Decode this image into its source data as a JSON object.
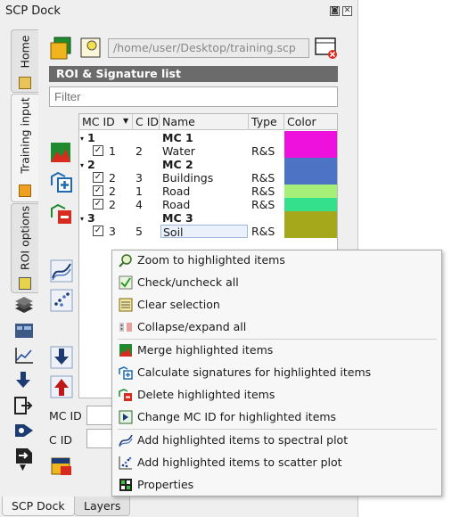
{
  "dock": {
    "title": "SCP Dock",
    "float_glyph": "◙",
    "close_glyph": "✕"
  },
  "vertical_tabs": [
    "Home",
    "Training input",
    "ROI options"
  ],
  "toolbar": {
    "path": "/home/user/Desktop/training.scp"
  },
  "roi_list": {
    "header": "ROI & Signature list",
    "filter_placeholder": "Filter",
    "columns": [
      "MC ID",
      "C ID",
      "Name",
      "Type",
      "Color"
    ],
    "sort_glyph": "▼",
    "groups": [
      {
        "mc_id": "1",
        "name": "MC 1",
        "color": "#ee11dd",
        "items": [
          {
            "mc_id": "1",
            "c_id": "2",
            "name": "Water",
            "type": "R&S",
            "color": "#ee11dd"
          }
        ]
      },
      {
        "mc_id": "2",
        "name": "MC 2",
        "color": "#4d74c4",
        "items": [
          {
            "mc_id": "2",
            "c_id": "3",
            "name": "Buildings",
            "type": "R&S",
            "color": "#4d74c4"
          },
          {
            "mc_id": "2",
            "c_id": "1",
            "name": "Road",
            "type": "R&S",
            "color": "#a6f07a"
          },
          {
            "mc_id": "2",
            "c_id": "4",
            "name": "Road",
            "type": "R&S",
            "color": "#35e08c"
          }
        ]
      },
      {
        "mc_id": "3",
        "name": "MC 3",
        "color": "#a6a81b",
        "items": [
          {
            "mc_id": "3",
            "c_id": "5",
            "name": "Soil",
            "type": "R&S",
            "color": "#a6a81b"
          }
        ]
      }
    ]
  },
  "fields": {
    "mc_id_label": "MC ID",
    "c_id_label": "C ID"
  },
  "bottom_tabs": [
    "SCP Dock",
    "Layers"
  ],
  "context_menu": {
    "items": [
      {
        "label": "Zoom to highlighted items",
        "icon": "zoom-icon"
      },
      {
        "label": "Check/uncheck all",
        "icon": "check-icon"
      },
      {
        "label": "Clear selection",
        "icon": "clear-selection-icon"
      },
      {
        "label": "Collapse/expand all",
        "icon": "collapse-icon"
      },
      {
        "label": "Merge highlighted items",
        "icon": "merge-icon"
      },
      {
        "label": "Calculate signatures for highlighted items",
        "icon": "calculate-signature-icon"
      },
      {
        "label": "Delete highlighted items",
        "icon": "delete-icon"
      },
      {
        "label": "Change MC ID for highlighted items",
        "icon": "change-id-icon"
      },
      {
        "label": "Add highlighted items to spectral plot",
        "icon": "spectral-plot-icon"
      },
      {
        "label": "Add highlighted items to scatter plot",
        "icon": "scatter-plot-icon"
      },
      {
        "label": "Properties",
        "icon": "properties-icon"
      }
    ]
  }
}
